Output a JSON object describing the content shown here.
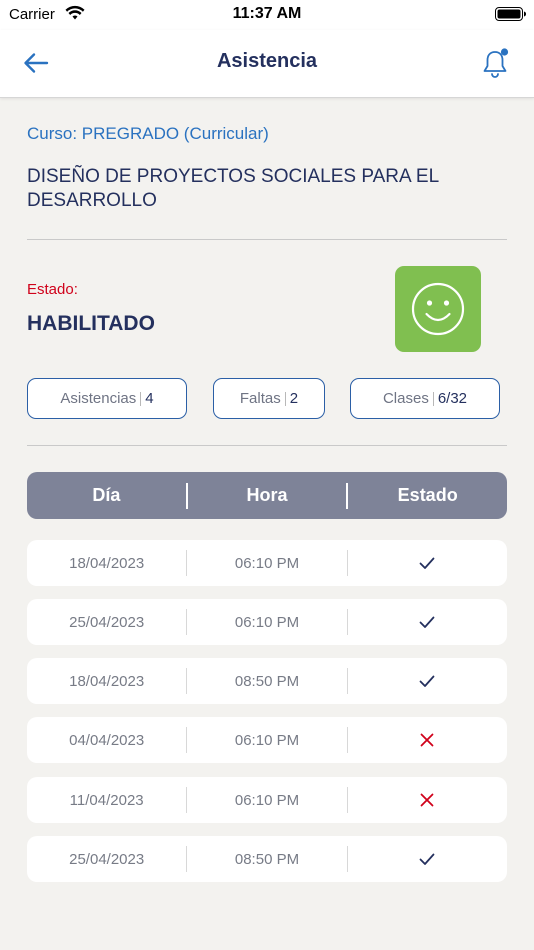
{
  "status_bar": {
    "carrier": "Carrier",
    "time": "11:37 AM"
  },
  "nav": {
    "title": "Asistencia",
    "back_icon": "arrow-left-icon",
    "bell_icon": "bell-icon"
  },
  "course": {
    "type": "Curso: PREGRADO (Curricular)",
    "name": "DISEÑO DE PROYECTOS SOCIALES PARA EL DESARROLLO"
  },
  "estado": {
    "label": "Estado:",
    "value": "HABILITADO",
    "icon": "smiley-face-icon",
    "color": "#80bf50"
  },
  "summary": {
    "asistencias_label": "Asistencias",
    "asistencias_value": "4",
    "faltas_label": "Faltas",
    "faltas_value": "2",
    "clases_label": "Clases",
    "clases_value": "6/32"
  },
  "table": {
    "headers": [
      "Día",
      "Hora",
      "Estado"
    ],
    "rows": [
      {
        "dia": "18/04/2023",
        "hora": "06:10 PM",
        "estado": "present"
      },
      {
        "dia": "25/04/2023",
        "hora": "06:10 PM",
        "estado": "present"
      },
      {
        "dia": "18/04/2023",
        "hora": "08:50 PM",
        "estado": "present"
      },
      {
        "dia": "04/04/2023",
        "hora": "06:10 PM",
        "estado": "absent"
      },
      {
        "dia": "11/04/2023",
        "hora": "06:10 PM",
        "estado": "absent"
      },
      {
        "dia": "25/04/2023",
        "hora": "08:50 PM",
        "estado": "present"
      }
    ]
  },
  "colors": {
    "accent": "#2a72c0",
    "alert": "#d0021b",
    "absent": "#d0021b",
    "present": "#24305e",
    "header_bg": "#7e8398"
  }
}
